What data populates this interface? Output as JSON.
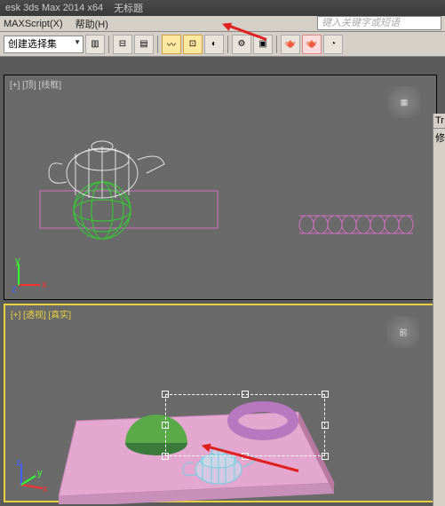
{
  "titlebar": {
    "app": "esk 3ds Max 2014 x64",
    "file": "无标题"
  },
  "menu": {
    "maxscript": "MAXScript(X)",
    "help": "帮助(H)"
  },
  "search": {
    "placeholder": "键入关键字或短语"
  },
  "toolbar": {
    "dropdown": "创建选择集"
  },
  "viewport": {
    "top": {
      "label": "[+] [顶] [线框]"
    },
    "persp": {
      "label": "[+] [透视] [真实]",
      "cube": "前"
    }
  },
  "side": {
    "tab1": "Tr",
    "tab2": "修"
  }
}
